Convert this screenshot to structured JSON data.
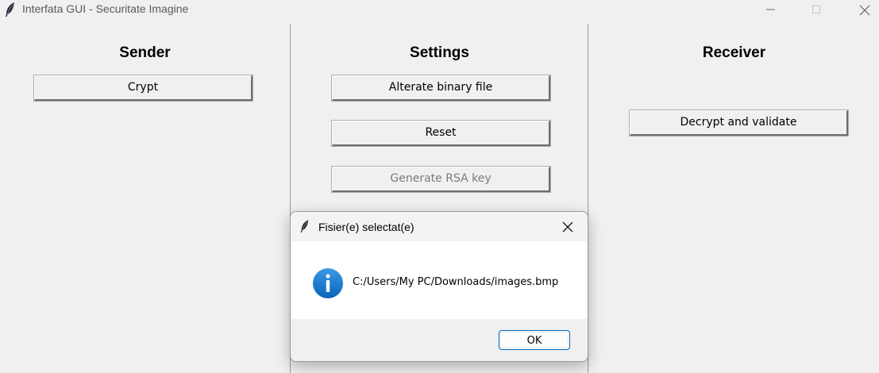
{
  "window": {
    "title": "Interfata GUI - Securitate Imagine",
    "app_icon": "feather-icon",
    "controls": [
      "minimize-icon",
      "maximize-icon",
      "close-icon"
    ]
  },
  "sender": {
    "heading": "Sender",
    "crypt_label": "Crypt"
  },
  "settings": {
    "heading": "Settings",
    "alterate_label": "Alterate binary file",
    "reset_label": "Reset",
    "generate_rsa_label": "Generate RSA key",
    "generate_rsa_enabled": false
  },
  "receiver": {
    "heading": "Receiver",
    "decrypt_label": "Decrypt and validate"
  },
  "dialog": {
    "title": "Fisier(e) selectat(e)",
    "icon": "info-icon",
    "message": "C:/Users/My PC/Downloads/images.bmp",
    "ok_label": "OK",
    "accent_color": "#0067c0",
    "info_icon_color": "#1a73c9"
  }
}
